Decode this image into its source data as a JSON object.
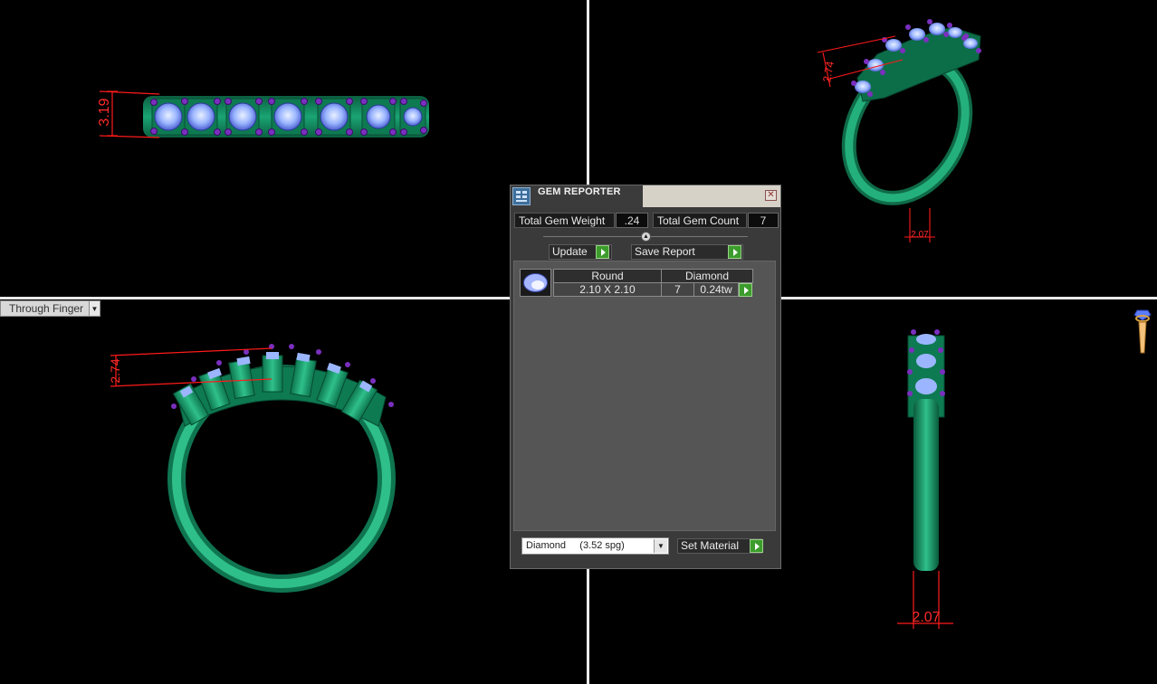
{
  "viewport_top_left": {
    "dimension": "3.19"
  },
  "viewport_top_right": {
    "dimensions": [
      "2.74",
      "2.07"
    ]
  },
  "viewport_bottom_left": {
    "dimension": "2.74"
  },
  "viewport_bottom_right": {
    "dimension": "2.07"
  },
  "view_mode": {
    "value": "Through Finger"
  },
  "gem_reporter": {
    "title": "GEM REPORTER",
    "total_weight_label": "Total Gem Weight",
    "total_weight_value": ".24",
    "total_count_label": "Total Gem Count",
    "total_count_value": "7",
    "update_label": "Update",
    "save_report_label": "Save Report",
    "gem_row": {
      "shape": "Round",
      "material": "Diamond",
      "size": "2.10 X 2.10",
      "count": "7",
      "weight": "0.24tw"
    },
    "material_select_value": "Diamond     (3.52 spg)",
    "set_material_label": "Set Material"
  },
  "colors": {
    "ring_metal": "#1f9a6e",
    "gem_blue": "#8fb0ff",
    "prong_purple": "#6a28a8",
    "dimension_red": "#ff1a1a",
    "accent_green_button": "#3c9c2c"
  }
}
